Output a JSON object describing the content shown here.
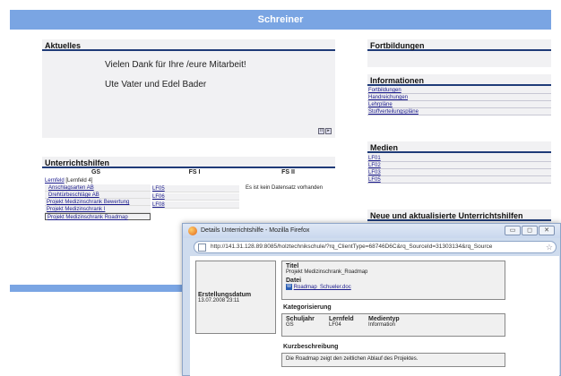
{
  "header": {
    "title": "Schreiner"
  },
  "aktuelles": {
    "title": "Aktuelles",
    "line1": "Vielen Dank für Ihre /eure Mitarbeit!",
    "line2": "Ute Vater und Edel Bader"
  },
  "unterrichtshilfen": {
    "title": "Unterrichtshilfen",
    "col_gs": "GS",
    "col_fs1": "FS I",
    "col_fs2": "FS II",
    "gs_head_link": "Lernfeld",
    "gs_head_text": " [Lernfeld 4]",
    "gs_items": [
      "Anschlagsarten AB",
      "Drehtürbeschläge AB",
      "Projekt Medizinschrank Bewertung",
      "Projekt Medizinschrank I",
      "Projekt Medizinschrank Roadmap"
    ],
    "fs1_items": [
      "LF05",
      "LF06",
      "LF08"
    ],
    "fs2_text": "Es ist kein Datensatz vorhanden"
  },
  "fortbildungen": {
    "title": "Fortbildungen"
  },
  "informationen": {
    "title": "Informationen",
    "items": [
      "Fortbildungen",
      "Handreichungen",
      "Lehrpläne",
      "Stoffverteilungspläne"
    ]
  },
  "medien": {
    "title": "Medien",
    "items": [
      "LF01",
      "LF02",
      "LF03",
      "LF05"
    ]
  },
  "neue": {
    "title": "Neue und aktualisierte Unterrichtshilfen"
  },
  "popup": {
    "window_title": "Details Unterrichtshilfe - Mozilla Firefox",
    "url": "http://141.31.128.89:8085/holztechnikschule/?rq_ClientType=68746D6C&rq_SourceId=31303134&rq_Source",
    "erstellungsdatum_label": "Erstellungsdatum",
    "erstellungsdatum_value": "13.07.2008 23:11",
    "titel_label": "Titel",
    "titel_value": "Projekt Medizinschrank_Roadmap",
    "datei_label": "Datei",
    "datei_value": "Roadmap_Schueler.doc",
    "kategorisierung_label": "Kategorisierung",
    "schuljahr_label": "Schuljahr",
    "schuljahr_value": "GS",
    "lernfeld_label": "Lernfeld",
    "lernfeld_value": "LF04",
    "medientyp_label": "Medientyp",
    "medientyp_value": "Information",
    "kurzbeschreibung_label": "Kurzbeschreibung",
    "kurzbeschreibung_value": "Die Roadmap zeigt den zeitlichen Ablauf des Projektes.",
    "buttons": {
      "minimize": "▭",
      "maximize": "◻",
      "close": "✕"
    }
  }
}
